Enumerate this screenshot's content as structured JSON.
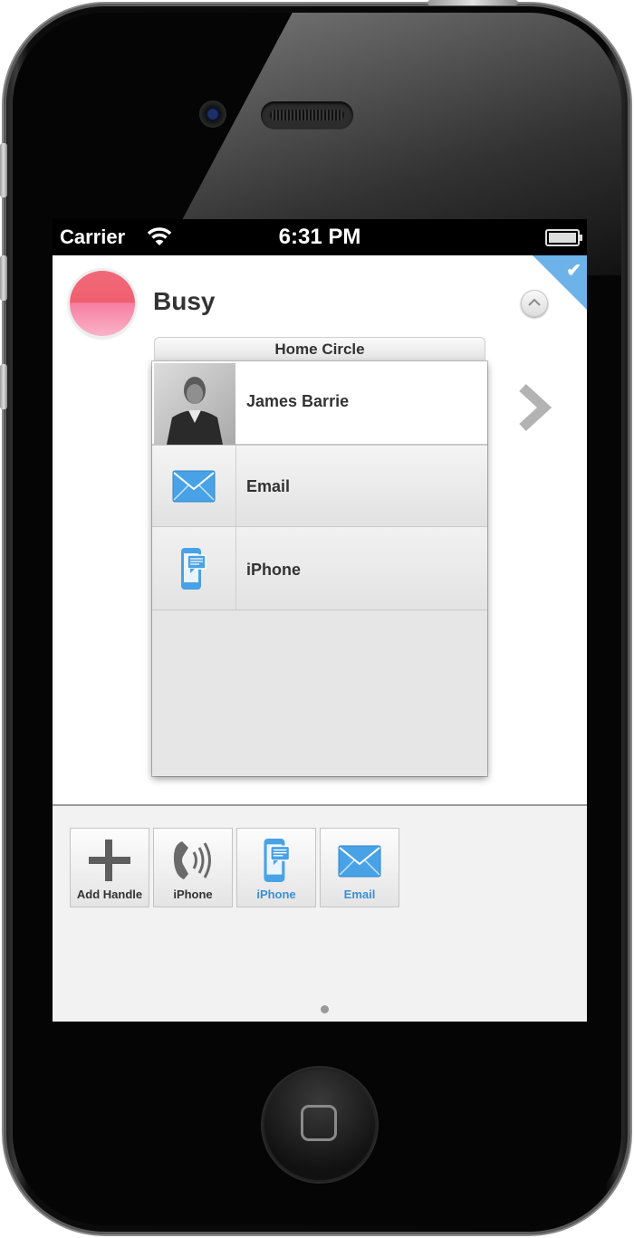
{
  "status_bar": {
    "carrier": "Carrier",
    "time": "6:31 PM"
  },
  "presence": {
    "status": "Busy",
    "status_color": "#f06a7a",
    "selected_flag_color": "#6db3ea"
  },
  "circle": {
    "name": "Home Circle",
    "contact": {
      "name": "James Barrie"
    },
    "handles": [
      {
        "label": "Email",
        "icon": "envelope-icon"
      },
      {
        "label": "iPhone",
        "icon": "phone-message-icon"
      }
    ]
  },
  "tray": {
    "tiles": [
      {
        "label": "Add Handle",
        "icon": "plus-icon"
      },
      {
        "label": "iPhone",
        "icon": "phone-ring-icon"
      },
      {
        "label": "iPhone",
        "icon": "phone-message-icon"
      },
      {
        "label": "Email",
        "icon": "envelope-icon"
      }
    ],
    "accent_color": "#3a8fd8"
  }
}
